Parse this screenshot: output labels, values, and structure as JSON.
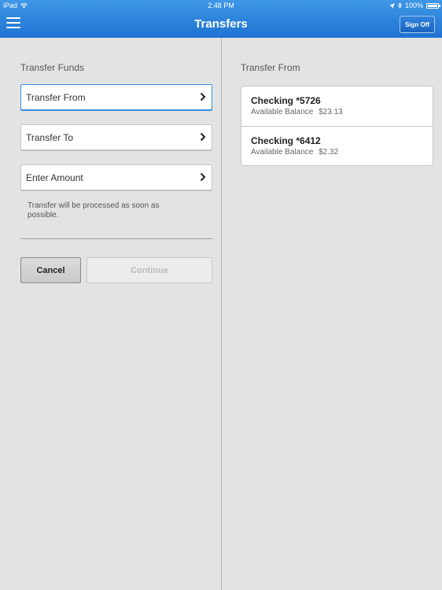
{
  "status_bar": {
    "device": "iPad",
    "time": "2:48 PM",
    "battery": "100%",
    "battery_level": 1.0
  },
  "nav": {
    "title": "Transfers",
    "sign_off_label": "Sign Off"
  },
  "left": {
    "section_title": "Transfer Funds",
    "fields": [
      {
        "label": "Transfer From",
        "focused": true
      },
      {
        "label": "Transfer To",
        "focused": false
      },
      {
        "label": "Enter Amount",
        "focused": false
      }
    ],
    "hint": "Transfer will be processed as soon as possible.",
    "cancel_label": "Cancel",
    "continue_label": "Continue"
  },
  "right": {
    "section_title": "Transfer From",
    "accounts": [
      {
        "name": "Checking *5726",
        "balance_label": "Available Balance",
        "balance": "$23.13"
      },
      {
        "name": "Checking *6412",
        "balance_label": "Available Balance",
        "balance": "$2.32"
      }
    ]
  },
  "colors": {
    "header_top": "#3f97e6",
    "header_bottom": "#1f73d3",
    "focus_border": "#3b8ee0",
    "background": "#e3e3e3"
  }
}
